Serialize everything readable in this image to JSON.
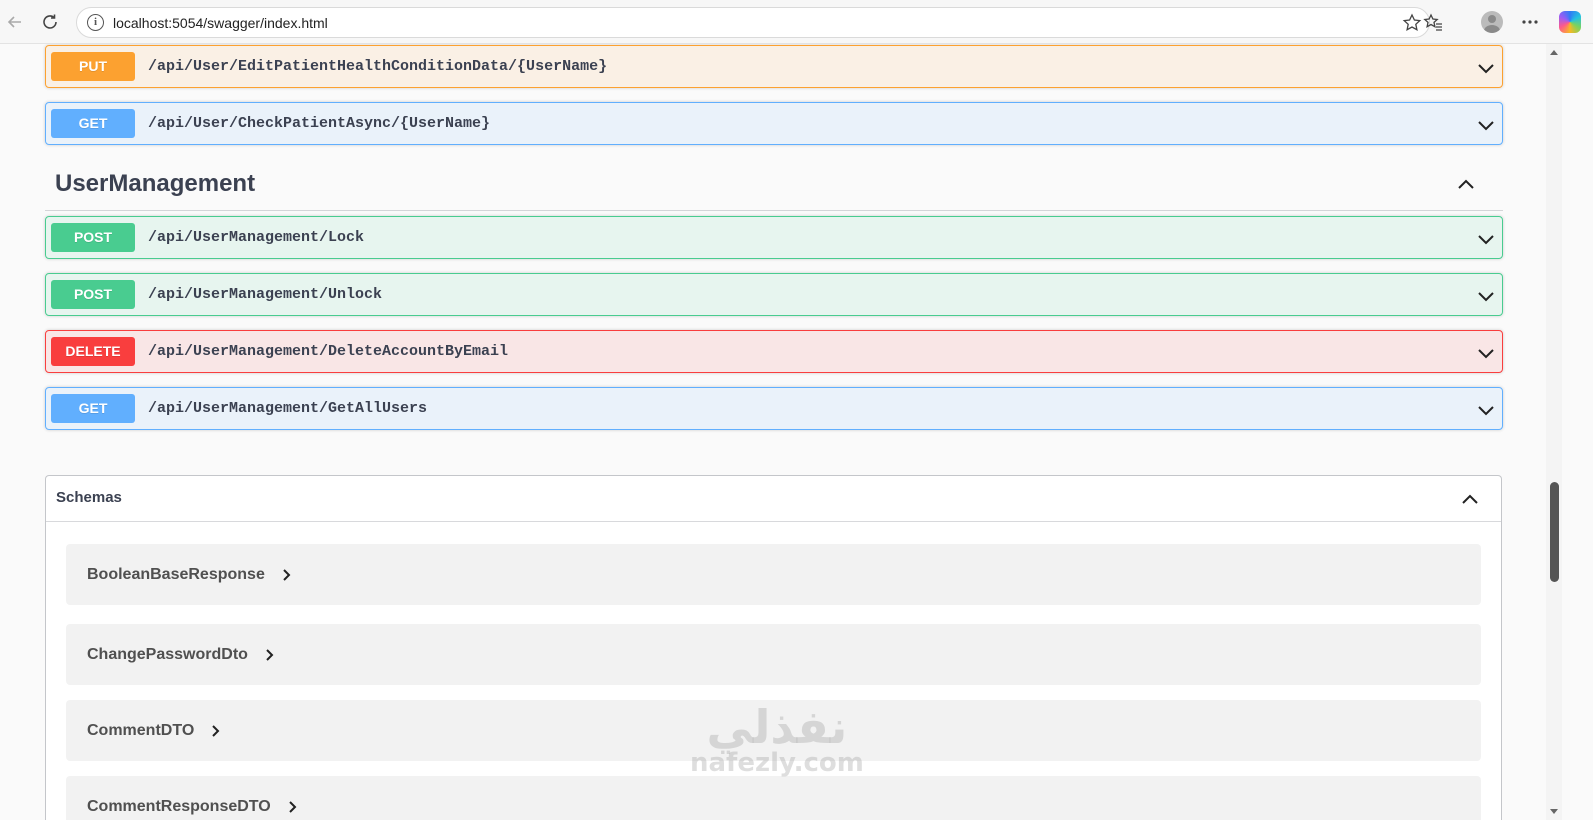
{
  "browser": {
    "url": "localhost:5054/swagger/index.html"
  },
  "operations_top": [
    {
      "method": "PUT",
      "path": "/api/User/EditPatientHealthConditionData/{UserName}"
    },
    {
      "method": "GET",
      "path": "/api/User/CheckPatientAsync/{UserName}"
    }
  ],
  "tag": {
    "title": "UserManagement",
    "operations": [
      {
        "method": "POST",
        "path": "/api/UserManagement/Lock"
      },
      {
        "method": "POST",
        "path": "/api/UserManagement/Unlock"
      },
      {
        "method": "DELETE",
        "path": "/api/UserManagement/DeleteAccountByEmail"
      },
      {
        "method": "GET",
        "path": "/api/UserManagement/GetAllUsers"
      }
    ]
  },
  "schemas": {
    "label": "Schemas",
    "models": [
      {
        "name": "BooleanBaseResponse"
      },
      {
        "name": "ChangePasswordDto"
      },
      {
        "name": "CommentDTO"
      },
      {
        "name": "CommentResponseDTO"
      }
    ]
  },
  "watermark": {
    "arabic": "نفذلي",
    "latin": "nafezly.com"
  },
  "colors": {
    "put": "#fca130",
    "get": "#61affe",
    "post": "#49cc90",
    "delete": "#f93e3e"
  }
}
